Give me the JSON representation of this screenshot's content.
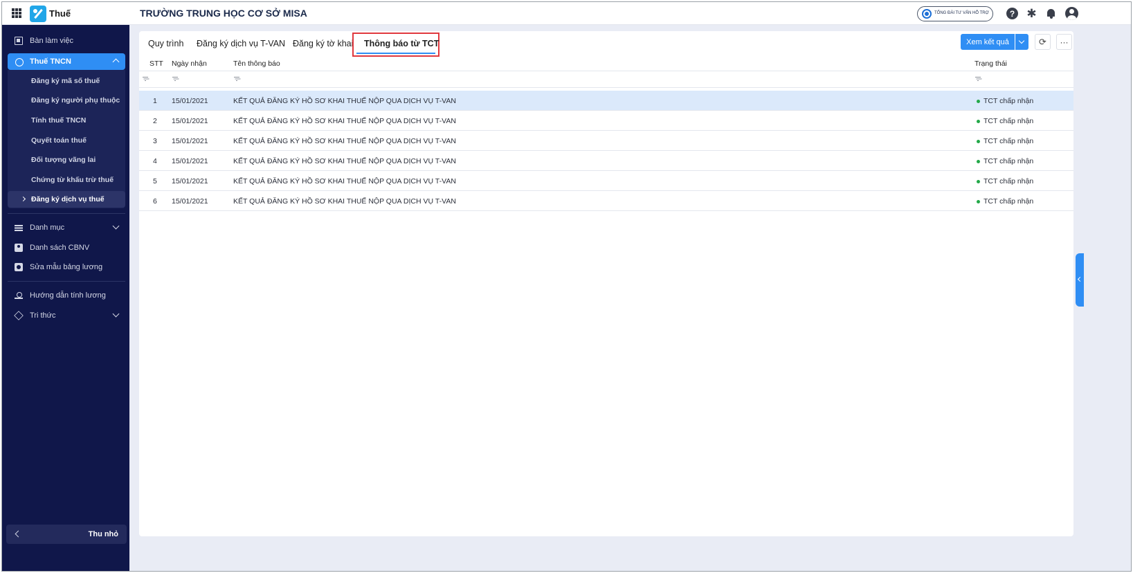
{
  "header": {
    "app_name": "Thuế",
    "org_title": "TRƯỜNG TRUNG HỌC CƠ SỞ MISA",
    "support_label": "TỔNG ĐÀI TƯ VẤN HỖ TRỢ",
    "help_glyph": "?",
    "gear_glyph": "✱"
  },
  "sidebar": {
    "workspace": "Bàn làm việc",
    "tax_group": "Thuế TNCN",
    "tax_items": [
      "Đăng ký mã số thuế",
      "Đăng ký người phụ thuộc",
      "Tính thuế TNCN",
      "Quyết toán thuế",
      "Đối tượng vãng lai",
      "Chứng từ khấu trừ thuế",
      "Đăng ký dịch vụ thuế"
    ],
    "catalog": "Danh mục",
    "staff_list": "Danh sách CBNV",
    "payslip_template": "Sửa mẫu bảng lương",
    "payroll_guide": "Hướng dẫn tính lương",
    "knowledge": "Tri thức",
    "collapse_label": "Thu nhỏ"
  },
  "tabs": [
    "Quy trình",
    "Đăng ký dịch vụ T-VAN",
    "Đăng ký tờ khai",
    "Thông báo từ TCT"
  ],
  "active_tab": "Thông báo từ TCT",
  "toolbar": {
    "view_results": "Xem kết quả",
    "refresh_glyph": "⟳",
    "more_glyph": "···"
  },
  "table": {
    "columns": [
      "STT",
      "Ngày nhận",
      "Tên thông báo",
      "Trạng thái"
    ],
    "rows": [
      {
        "stt": "1",
        "date": "15/01/2021",
        "name": "KẾT QUẢ ĐĂNG KÝ HỒ SƠ KHAI THUẾ NỘP QUA DỊCH VỤ T-VAN",
        "status": "TCT chấp nhận"
      },
      {
        "stt": "2",
        "date": "15/01/2021",
        "name": "KẾT QUẢ ĐĂNG KÝ HỒ SƠ KHAI THUẾ NỘP QUA DỊCH VỤ T-VAN",
        "status": "TCT chấp nhận"
      },
      {
        "stt": "3",
        "date": "15/01/2021",
        "name": "KẾT QUẢ ĐĂNG KÝ HỒ SƠ KHAI THUẾ NỘP QUA DỊCH VỤ T-VAN",
        "status": "TCT chấp nhận"
      },
      {
        "stt": "4",
        "date": "15/01/2021",
        "name": "KẾT QUẢ ĐĂNG KÝ HỒ SƠ KHAI THUẾ NỘP QUA DỊCH VỤ T-VAN",
        "status": "TCT chấp nhận"
      },
      {
        "stt": "5",
        "date": "15/01/2021",
        "name": "KẾT QUẢ ĐĂNG KÝ HỒ SƠ KHAI THUẾ NỘP QUA DỊCH VỤ T-VAN",
        "status": "TCT chấp nhận"
      },
      {
        "stt": "6",
        "date": "15/01/2021",
        "name": "KẾT QUẢ ĐĂNG KÝ HỒ SƠ KHAI THUẾ NỘP QUA DỊCH VỤ T-VAN",
        "status": "TCT chấp nhận"
      }
    ]
  },
  "colors": {
    "sidebar_bg": "#10174a",
    "accent": "#2f8ef4",
    "status_ok": "#23a848",
    "highlight_border": "#e0383e",
    "selected_row": "#dbe9fb"
  }
}
